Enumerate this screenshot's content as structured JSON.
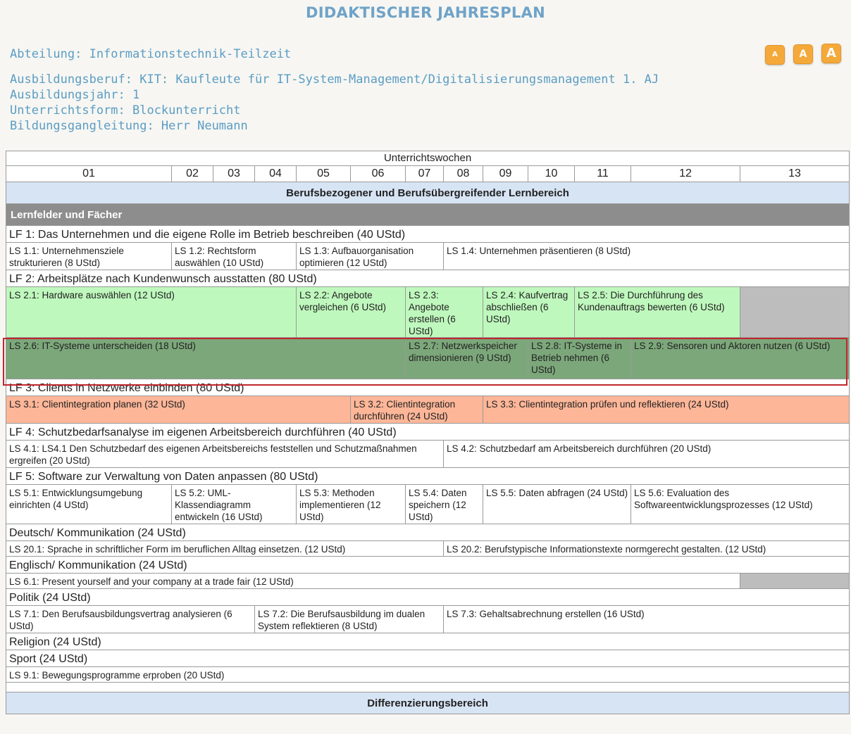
{
  "header": {
    "title": "DIDAKTISCHER JAHRESPLAN",
    "abteilung": "Abteilung: Informationstechnik-Teilzeit",
    "beruf": "Ausbildungsberuf: KIT: Kaufleute für IT-System-Management/Digitalisierungsmanagement 1. AJ",
    "jahr": "Ausbildungsjahr: 1",
    "form": "Unterrichtsform: Blockunterricht",
    "leitung": "Bildungsgangleitung: Herr Neumann"
  },
  "font_buttons": [
    "A",
    "A",
    "A"
  ],
  "table": {
    "weeks_header": "Unterrichtswochen",
    "weeks": [
      "01",
      "02",
      "03",
      "04",
      "05",
      "06",
      "07",
      "08",
      "09",
      "10",
      "11",
      "12",
      "13"
    ],
    "bereich1": "Berufsbezogener und Berufsübergreifender Lernbereich",
    "lernfelder_header": "Lernfelder und Fächer",
    "lf1": {
      "title": "LF 1: Das Unternehmen und die eigene Rolle im Betrieb beschreiben (40 UStd)",
      "ls": [
        "LS 1.1: Unternehmensziele strukturieren (8 UStd)",
        "LS 1.2: Rechtsform auswählen (10 UStd)",
        "LS 1.3: Aufbauorganisation optimieren (12 UStd)",
        "LS 1.4: Unternehmen präsentieren (8 UStd)"
      ]
    },
    "lf2": {
      "title": "LF 2: Arbeitsplätze nach Kundenwunsch ausstatten (80 UStd)",
      "ls_a": [
        "LS 2.1: Hardware auswählen (12 UStd)",
        "LS 2.2: Angebote vergleichen (6 UStd)",
        "LS 2.3: Angebote erstellen (6 UStd)",
        "LS 2.4: Kaufvertrag abschließen (6 UStd)",
        "LS 2.5: Die Durchführung des Kundenauftrags bewerten (6 UStd)"
      ],
      "ls_b": [
        "LS 2.6: IT-Systeme unterscheiden (18 UStd)",
        "LS 2.7: Netzwerkspeicher dimensionieren (9 UStd)",
        "LS 2.8: IT-Systeme in Betrieb nehmen (6 UStd)",
        "LS 2.9: Sensoren und Aktoren nutzen (6 UStd)"
      ]
    },
    "lf3": {
      "title": "LF 3: Clients in Netzwerke einbinden (80 UStd)",
      "ls": [
        "LS 3.1: Clientintegration planen (32 UStd)",
        "LS 3.2: Clientintegration durchführen (24 UStd)",
        "LS 3.3: Clientintegration prüfen und reflektieren (24 UStd)"
      ]
    },
    "lf4": {
      "title": "LF 4: Schutzbedarfsanalyse im eigenen Arbeitsbereich durchführen (40 UStd)",
      "ls": [
        "LS 4.1: LS4.1 Den Schutzbedarf des eigenen Arbeitsbereichs feststellen und Schutzmaßnahmen ergreifen (20 UStd)",
        "LS 4.2: Schutzbedarf am Arbeitsbereich durchführen (20 UStd)"
      ]
    },
    "lf5": {
      "title": "LF 5: Software zur Verwaltung von Daten anpassen (80 UStd)",
      "ls": [
        "LS 5.1: Entwicklungsumgebung einrichten (4 UStd)",
        "LS 5.2: UML-Klassendiagramm entwickeln (16 UStd)",
        "LS 5.3: Methoden implementieren (12 UStd)",
        "LS 5.4: Daten speichern (12 UStd)",
        "LS 5.5: Daten abfragen (24 UStd)",
        "LS 5.6: Evaluation des Softwareentwicklungsprozesses (12 UStd)"
      ]
    },
    "deutsch": {
      "title": "Deutsch/ Kommunikation (24 UStd)",
      "ls": [
        "LS 20.1: Sprache in schriftlicher Form im beruflichen Alltag einsetzen. (12 UStd)",
        "LS 20.2: Berufstypische Informationstexte normgerecht gestalten. (12 UStd)"
      ]
    },
    "englisch": {
      "title": "Englisch/ Kommunikation (24 UStd)",
      "ls": [
        "LS 6.1: Present yourself and your company at a trade fair (12 UStd)"
      ]
    },
    "politik": {
      "title": "Politik (24 UStd)",
      "ls": [
        "LS 7.1: Den Berufsausbildungsvertrag analysieren (6 UStd)",
        "LS 7.2: Die Berufsausbildung im dualen System reflektieren (8 UStd)",
        "LS 7.3: Gehaltsabrechnung erstellen (16 UStd)"
      ]
    },
    "religion": {
      "title": "Religion (24 UStd)"
    },
    "sport": {
      "title": "Sport (24 UStd)",
      "ls": [
        "LS 9.1: Bewegungsprogramme erproben (20 UStd)"
      ]
    },
    "bereich2": "Differenzierungsbereich"
  },
  "colors": {
    "title": "#6fa3c8",
    "green": "#bff8bd",
    "dark_green": "#7ca77a",
    "orange": "#fdb698",
    "grey": "#bdbdbd",
    "bereich": "#d7e4f4"
  }
}
